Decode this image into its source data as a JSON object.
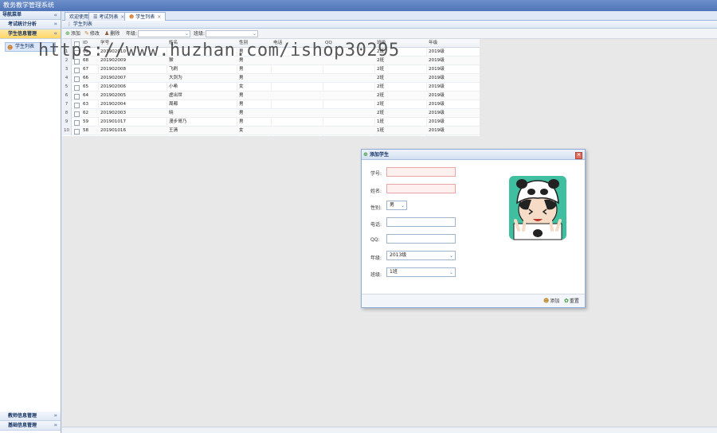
{
  "app": {
    "title": "教务教学管理系统"
  },
  "sidebar": {
    "header": "导航菜单",
    "sections_top": [
      {
        "label": "考试统计分析",
        "active": false
      },
      {
        "label": "学生信息管理",
        "active": true
      }
    ],
    "item": {
      "label": "学生列表"
    },
    "sections_bottom": [
      {
        "label": "教师信息管理"
      },
      {
        "label": "基础信息管理"
      }
    ]
  },
  "tabs": [
    {
      "label": "欢迎使用",
      "closable": false,
      "active": false
    },
    {
      "label": "考试列表",
      "closable": true,
      "active": false
    },
    {
      "label": "学生列表",
      "closable": true,
      "active": true
    }
  ],
  "panel": {
    "title": "学生列表"
  },
  "toolbar": {
    "add": "添加",
    "edit": "修改",
    "delete": "删除",
    "grade_label": "年级:",
    "class_label": "班级:"
  },
  "grid": {
    "headers": {
      "id": "ID",
      "number": "学号",
      "name": "姓名",
      "sex": "性别",
      "phone": "电话",
      "qq": "QQ",
      "class": "班级",
      "grade": "年级"
    },
    "rows": [
      {
        "rn": "1",
        "id": "69",
        "number": "201902010",
        "name": "",
        "sex": "男",
        "class": "2班",
        "grade": "2019级"
      },
      {
        "rn": "2",
        "id": "68",
        "number": "201902009",
        "name": "猴",
        "sex": "男",
        "class": "2班",
        "grade": "2019级"
      },
      {
        "rn": "3",
        "id": "67",
        "number": "201902008",
        "name": "飞刷",
        "sex": "男",
        "class": "2班",
        "grade": "2019级"
      },
      {
        "rn": "4",
        "id": "66",
        "number": "201902007",
        "name": "大剑为",
        "sex": "男",
        "class": "2班",
        "grade": "2019级"
      },
      {
        "rn": "5",
        "id": "65",
        "number": "201902006",
        "name": "小希",
        "sex": "女",
        "class": "2班",
        "grade": "2019级"
      },
      {
        "rn": "6",
        "id": "64",
        "number": "201902005",
        "name": "虚出世",
        "sex": "男",
        "class": "2班",
        "grade": "2019级"
      },
      {
        "rn": "7",
        "id": "63",
        "number": "201902004",
        "name": "周都",
        "sex": "男",
        "class": "2班",
        "grade": "2019级"
      },
      {
        "rn": "8",
        "id": "62",
        "number": "201902003",
        "name": "晓",
        "sex": "男",
        "class": "2班",
        "grade": "2019级"
      },
      {
        "rn": "9",
        "id": "59",
        "number": "201901017",
        "name": "漫步哥乃",
        "sex": "男",
        "class": "1班",
        "grade": "2019级"
      },
      {
        "rn": "10",
        "id": "58",
        "number": "201901016",
        "name": "王清",
        "sex": "女",
        "class": "1班",
        "grade": "2019级"
      }
    ]
  },
  "dialog": {
    "title": "添加学生",
    "fields": {
      "number": {
        "label": "学号:",
        "value": ""
      },
      "name": {
        "label": "姓名:",
        "value": ""
      },
      "sex": {
        "label": "性别:",
        "value": "男"
      },
      "phone": {
        "label": "电话:",
        "value": ""
      },
      "qq": {
        "label": "QQ:",
        "value": ""
      },
      "grade": {
        "label": "年级:",
        "value": "2013级"
      },
      "class": {
        "label": "班级:",
        "value": "1班"
      }
    },
    "buttons": {
      "add": "添加",
      "reset": "重置"
    }
  },
  "watermark": "https://www.huzhan.com/ishop30295",
  "colors": {
    "accent": "#4f74b8",
    "active_section": "#ffd566",
    "required_field": "#fff0f0"
  }
}
